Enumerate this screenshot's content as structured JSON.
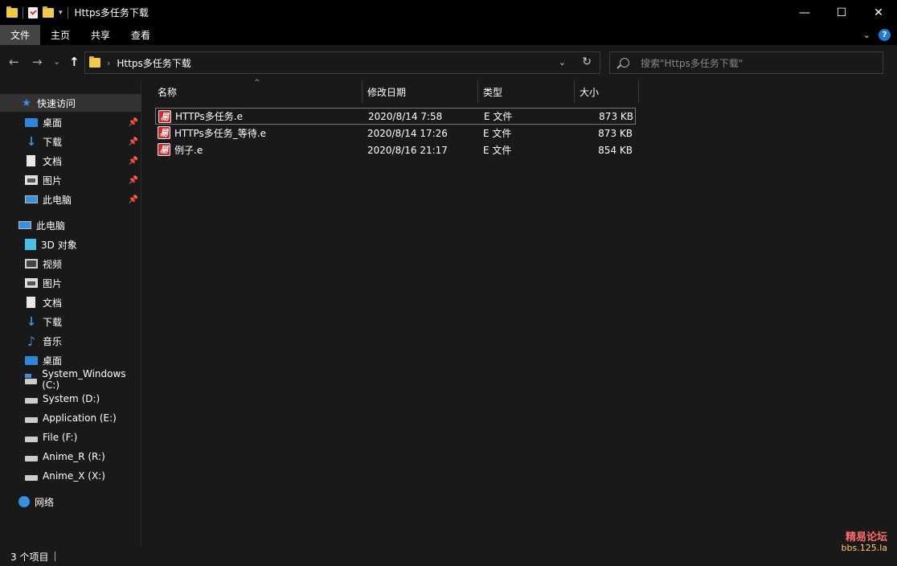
{
  "window": {
    "title": "Https多任务下载",
    "minimize": "—",
    "maximize": "☐",
    "close": "✕"
  },
  "quick_access_toolbar": {
    "dropdown": "▾"
  },
  "ribbon": {
    "tabs": [
      "文件",
      "主页",
      "共享",
      "查看"
    ],
    "active_tab": "文件",
    "expand": "⌄",
    "help": "?"
  },
  "navigation": {
    "back": "←",
    "forward": "→",
    "recent": "⌄",
    "up": "↑",
    "address_separator": "›",
    "address_path": "Https多任务下载",
    "address_dropdown": "⌄",
    "refresh": "↻",
    "search_placeholder": "搜索\"Https多任务下载\""
  },
  "sidebar": {
    "quick_access": {
      "label": "快速访问",
      "items": [
        {
          "label": "桌面",
          "icon": "desktop-icon",
          "pinned": true
        },
        {
          "label": "下载",
          "icon": "download-icon",
          "pinned": true
        },
        {
          "label": "文档",
          "icon": "document-icon",
          "pinned": true
        },
        {
          "label": "图片",
          "icon": "pictures-icon",
          "pinned": true
        },
        {
          "label": "此电脑",
          "icon": "computer-icon",
          "pinned": true
        }
      ]
    },
    "this_pc": {
      "label": "此电脑",
      "items": [
        {
          "label": "3D 对象",
          "icon": "3d-objects-icon"
        },
        {
          "label": "视频",
          "icon": "video-icon"
        },
        {
          "label": "图片",
          "icon": "pictures-icon"
        },
        {
          "label": "文档",
          "icon": "document-icon"
        },
        {
          "label": "下载",
          "icon": "download-icon"
        },
        {
          "label": "音乐",
          "icon": "music-icon"
        },
        {
          "label": "桌面",
          "icon": "desktop-icon"
        },
        {
          "label": "System_Windows (C:)",
          "icon": "system-drive-icon"
        },
        {
          "label": "System (D:)",
          "icon": "drive-icon"
        },
        {
          "label": "Application (E:)",
          "icon": "drive-icon"
        },
        {
          "label": "File (F:)",
          "icon": "drive-icon"
        },
        {
          "label": "Anime_R (R:)",
          "icon": "drive-icon"
        },
        {
          "label": "Anime_X (X:)",
          "icon": "drive-icon"
        }
      ]
    },
    "network": {
      "label": "网络",
      "icon": "network-icon"
    },
    "pin_glyph": "📌"
  },
  "file_list": {
    "columns": {
      "name": "名称",
      "modified": "修改日期",
      "type": "类型",
      "size": "大小"
    },
    "sort_indicator": "^",
    "rows": [
      {
        "name": "HTTPs多任务.e",
        "modified": "2020/8/14 7:58",
        "type": "E 文件",
        "size": "873 KB"
      },
      {
        "name": "HTTPs多任务_等待.e",
        "modified": "2020/8/14 17:26",
        "type": "E 文件",
        "size": "873 KB"
      },
      {
        "name": "例子.e",
        "modified": "2020/8/16 21:17",
        "type": "E 文件",
        "size": "854 KB"
      }
    ],
    "file_icon_glyph": "易"
  },
  "status_bar": {
    "item_count": "3 个项目"
  },
  "watermark": {
    "line1": "精易论坛",
    "line2": "bbs.125.la"
  }
}
